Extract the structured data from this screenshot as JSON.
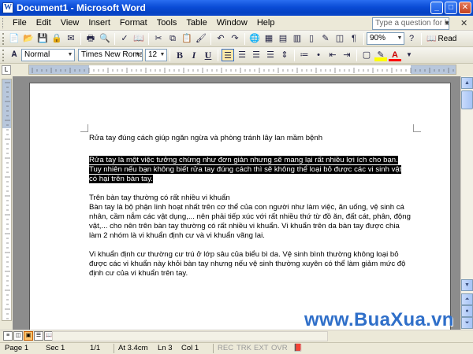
{
  "window": {
    "title": "Document1 - Microsoft Word",
    "app_icon": "W"
  },
  "menu": [
    "File",
    "Edit",
    "View",
    "Insert",
    "Format",
    "Tools",
    "Table",
    "Window",
    "Help"
  ],
  "help_box": {
    "placeholder": "Type a question for help"
  },
  "standard_toolbar": {
    "zoom": "90%",
    "read_label": "Read"
  },
  "formatting_toolbar": {
    "style": "Normal",
    "font": "Times New Roman",
    "size": "12",
    "bold": "B",
    "italic": "I",
    "underline": "U",
    "a_letter": "A"
  },
  "document": {
    "title": "Rửa tay đúng cách giúp ngăn ngừa và phòng tránh lây lan mầm bệnh",
    "selected_lines": [
      "Rửa tay là một việc tưởng chừng như đơn giản nhưng sẽ mang lại rất nhiều lợi ích cho bạn.",
      "Tuy nhiên nếu bạn không biết rửa tay đúng cách thì sẽ không thể loại bỏ được các vi sinh vật",
      "có hại trên bàn tay."
    ],
    "para2_heading": "Trên bàn tay thường có rất nhiều vi khuẩn",
    "para2_body": "Bàn tay là bộ phận linh hoạt nhất trên cơ thể của con người như làm việc, ăn uống, vệ sinh cá nhân, cầm nắm các vật dụng,... nên phải tiếp xúc với rất nhiều thứ từ đồ ăn, đất cát, phân, động vật,... cho nên trên bàn tay  thường có rất nhiều vi khuẩn. Vi khuẩn trên da bàn tay được chia làm 2 nhóm là vi khuẩn định cư và vi khuẩn vãng lai.",
    "para3": "Vi khuẩn định cư thường cư trú ở lớp sâu của biểu bì da. Vệ sinh bình thường không loại bỏ được các vi khuẩn này khỏi bàn tay nhưng nếu vệ sinh thường xuyên có thể làm giảm mức độ định cư của vi khuẩn trên tay."
  },
  "status_bar": {
    "page": "Page 1",
    "sec": "Sec 1",
    "pages": "1/1",
    "at": "At 3.4cm",
    "ln": "Ln 3",
    "col": "Col 1",
    "rec": "REC",
    "trk": "TRK",
    "ext": "EXT",
    "ovr": "OVR"
  },
  "watermark": "www.BuaXua.vn",
  "colors": {
    "titlebar": "#0a4cd6",
    "highlight_bg": "#000000",
    "highlight_fg": "#ffffff",
    "watermark": "#2f6fc9"
  }
}
